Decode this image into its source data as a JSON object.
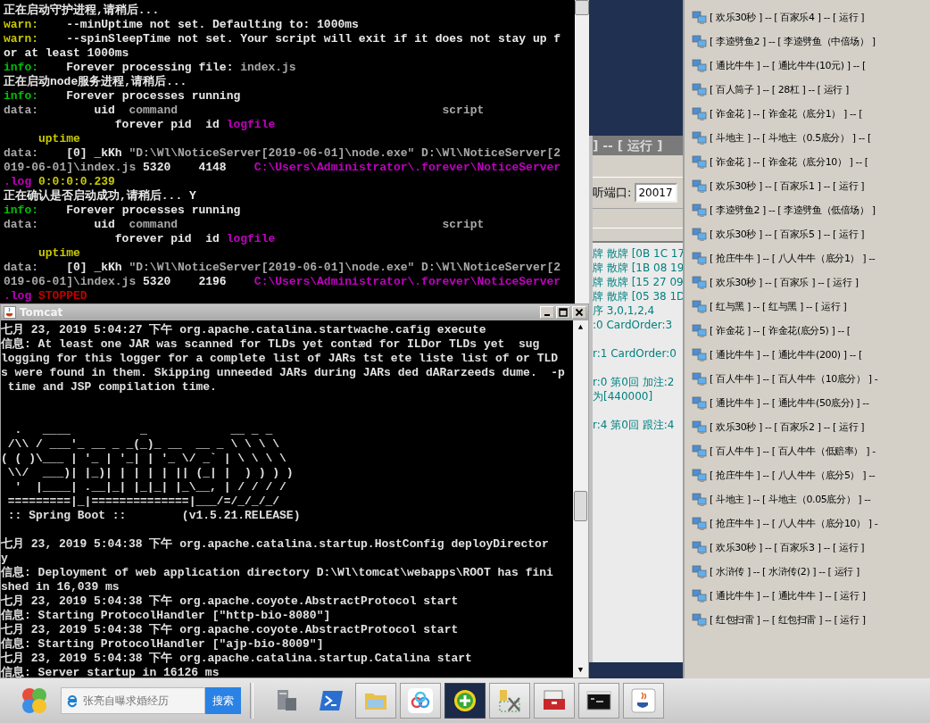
{
  "node_console": {
    "lines": [
      {
        "segments": [
          {
            "kind": "text",
            "text": "正在启动守护进程,请稍后..."
          }
        ]
      },
      {
        "segments": [
          {
            "kind": "warn",
            "text": "warn:"
          },
          {
            "kind": "text",
            "text": "    --minUptime not set. Defaulting to: 1000ms"
          }
        ]
      },
      {
        "segments": [
          {
            "kind": "warn",
            "text": "warn:"
          },
          {
            "kind": "text",
            "text": "    --spinSleepTime not set. Your script will exit if it does not stay up f"
          }
        ]
      },
      {
        "segments": [
          {
            "kind": "text",
            "text": "or at least 1000ms"
          }
        ]
      },
      {
        "segments": [
          {
            "kind": "info",
            "text": "info:"
          },
          {
            "kind": "text",
            "text": "    Forever processing file: "
          },
          {
            "kind": "muted",
            "text": "index.js"
          }
        ]
      },
      {
        "segments": [
          {
            "kind": "text",
            "text": "正在启动node服务进程,请稍后..."
          }
        ]
      },
      {
        "segments": [
          {
            "kind": "info",
            "text": "info:"
          },
          {
            "kind": "text",
            "text": "    Forever processes running"
          }
        ]
      },
      {
        "segments": [
          {
            "kind": "muted",
            "text": "data:"
          },
          {
            "kind": "text",
            "text": "        uid  "
          },
          {
            "kind": "muted",
            "text": "command                                      script"
          }
        ]
      },
      {
        "segments": [
          {
            "kind": "text",
            "text": "                forever pid  id "
          },
          {
            "kind": "path",
            "text": "logfile"
          }
        ]
      },
      {
        "segments": [
          {
            "kind": "warn",
            "text": "     uptime"
          }
        ]
      },
      {
        "segments": [
          {
            "kind": "muted",
            "text": "data:"
          },
          {
            "kind": "text",
            "text": "    [0] _kKh "
          },
          {
            "kind": "muted",
            "text": "\"D:\\Wl\\NoticeServer[2019-06-01]\\node.exe\" D:\\Wl\\NoticeServer[2"
          }
        ]
      },
      {
        "segments": [
          {
            "kind": "muted",
            "text": "019-06-01]\\index.js"
          },
          {
            "kind": "text",
            "text": " 5320    4148    "
          },
          {
            "kind": "path",
            "text": "C:\\Users\\Administrator\\.forever\\NoticeServer"
          }
        ]
      },
      {
        "segments": [
          {
            "kind": "path",
            "text": ".log"
          },
          {
            "kind": "warn",
            "text": " 0:0:0:0.239"
          }
        ]
      },
      {
        "segments": [
          {
            "kind": "text",
            "text": "正在确认是否启动成功,请稍后... Y"
          }
        ]
      },
      {
        "segments": [
          {
            "kind": "info",
            "text": "info:"
          },
          {
            "kind": "text",
            "text": "    Forever processes running"
          }
        ]
      },
      {
        "segments": [
          {
            "kind": "muted",
            "text": "data:"
          },
          {
            "kind": "text",
            "text": "        uid  "
          },
          {
            "kind": "muted",
            "text": "command                                      script"
          }
        ]
      },
      {
        "segments": [
          {
            "kind": "text",
            "text": "                forever pid  id "
          },
          {
            "kind": "path",
            "text": "logfile"
          }
        ]
      },
      {
        "segments": [
          {
            "kind": "warn",
            "text": "     uptime"
          }
        ]
      },
      {
        "segments": [
          {
            "kind": "muted",
            "text": "data:"
          },
          {
            "kind": "text",
            "text": "    [0] _kKh "
          },
          {
            "kind": "muted",
            "text": "\"D:\\Wl\\NoticeServer[2019-06-01]\\node.exe\" D:\\Wl\\NoticeServer[2"
          }
        ]
      },
      {
        "segments": [
          {
            "kind": "muted",
            "text": "019-06-01]\\index.js"
          },
          {
            "kind": "text",
            "text": " 5320    2196    "
          },
          {
            "kind": "path",
            "text": "C:\\Users\\Administrator\\.forever\\NoticeServer"
          }
        ]
      },
      {
        "segments": [
          {
            "kind": "path",
            "text": ".log"
          },
          {
            "kind": "error",
            "text": " STOPPED"
          }
        ]
      }
    ]
  },
  "game_server_window": {
    "title": "] -- [ 运行 ]",
    "port_label": "听端口:",
    "port_value": "20017",
    "log_blocks": [
      [
        "牌 散牌 [0B 1C 17",
        "牌 散牌 [1B 08 19",
        "牌 散牌 [15 27 09",
        "牌 散牌 [05 38 1D",
        "序 3,0,1,2,4",
        ":0 CardOrder:3"
      ],
      [
        "r:1 CardOrder:0"
      ],
      [
        "r:0 第0回 加注:2",
        "为[440000]"
      ],
      [
        "r:4 第0回 跟注:4"
      ]
    ]
  },
  "room_list": [
    "[ 欢乐30秒 ] -- [ 百家乐4 ] -- [ 运行 ]",
    "[ 李逵劈鱼2 ] -- [ 李逵劈鱼（中倍场） ]",
    "[ 通比牛牛 ] -- [ 通比牛牛(10元) ] -- [",
    "[ 百人筒子 ] -- [ 28杠 ] -- [ 运行 ]",
    "[ 诈金花 ] -- [ 诈金花（底分1） ] -- [",
    "[ 斗地主 ] -- [ 斗地主（0.5底分） ] -- [",
    "[ 诈金花 ] -- [ 诈金花（底分10） ] -- [",
    "[ 欢乐30秒 ] -- [ 百家乐1 ] -- [ 运行 ]",
    "[ 李逵劈鱼2 ] -- [ 李逵劈鱼（低倍场） ]",
    "[ 欢乐30秒 ] -- [ 百家乐5 ] -- [ 运行 ]",
    "[ 抢庄牛牛 ] -- [ 八人牛牛（底分1） ] --",
    "[ 欢乐30秒 ] -- [ 百家乐 ] -- [ 运行 ]",
    "[ 红与黑 ] -- [ 红与黑 ] -- [ 运行 ]",
    "[ 诈金花 ] -- [ 诈金花(底分5) ] -- [",
    "[ 通比牛牛 ] -- [ 通比牛牛(200) ] -- [",
    "[ 百人牛牛 ] -- [ 百人牛牛（10底分） ] -",
    "[ 通比牛牛 ] -- [ 通比牛牛(50底分) ] --",
    "[ 欢乐30秒 ] -- [ 百家乐2 ] -- [ 运行 ]",
    "[ 百人牛牛 ] -- [ 百人牛牛（低赔率） ] -",
    "[ 抢庄牛牛 ] -- [ 八人牛牛（底分5） ] --",
    "[ 斗地主 ] -- [ 斗地主（0.05底分） ] --",
    "[ 抢庄牛牛 ] -- [ 八人牛牛（底分10） ] -",
    "[ 欢乐30秒 ] -- [ 百家乐3 ] -- [ 运行 ]",
    "[ 水浒传 ] -- [ 水浒传(2) ] -- [ 运行 ]",
    "[ 通比牛牛 ] -- [ 通比牛牛 ] -- [ 运行 ]",
    "[ 红包扫雷 ] -- [ 红包扫雷 ] -- [ 运行 ]"
  ],
  "tomcat_window": {
    "title": "Tomcat",
    "scroll_up": "▲",
    "scroll_down": "▼",
    "lines": [
      "七月 23, 2019 5:04:27 下午 org.apache.catalina.startwache.cafig execute",
      "信息: At least one JAR was scanned for TLDs yet contæd for ILDor TLDs yet  sug",
      "logging for this logger for a complete list of JARs tst ete liste list of or TLD",
      "s were found in them. Skipping unneeded JARs during JARs ded dARarzeeds dume.  -p",
      " time and JSP compilation time."
    ],
    "banner": [
      "  .   ____          _            __ _ _",
      " /\\\\ / ___'_ __ _ _(_)_ __  __ _ \\ \\ \\ \\",
      "( ( )\\___ | '_ | '_| | '_ \\/ _` | \\ \\ \\ \\",
      " \\\\/  ___)| |_)| | | | | || (_| |  ) ) ) )",
      "  '  |____| .__|_| |_|_| |_\\__, | / / / /",
      " =========|_|==============|___/=/_/_/_/",
      " :: Spring Boot ::        (v1.5.21.RELEASE)"
    ],
    "lines_after": [
      "七月 23, 2019 5:04:38 下午 org.apache.catalina.startup.HostConfig deployDirector",
      "y",
      "信息: Deployment of web application directory D:\\Wl\\tomcat\\webapps\\ROOT has fini",
      "shed in 16,039 ms",
      "七月 23, 2019 5:04:38 下午 org.apache.coyote.AbstractProtocol start",
      "信息: Starting ProtocolHandler [\"http-bio-8080\"]",
      "七月 23, 2019 5:04:38 下午 org.apache.coyote.AbstractProtocol start",
      "信息: Starting ProtocolHandler [\"ajp-bio-8009\"]",
      "七月 23, 2019 5:04:38 下午 org.apache.catalina.startup.Catalina start",
      "信息: Server startup in 16126 ms"
    ]
  },
  "taskbar": {
    "search": {
      "placeholder": "张亮自曝求婚经历",
      "button": "搜索"
    },
    "apps": [
      {
        "kind": "server",
        "selected": false
      },
      {
        "kind": "shell",
        "selected": false
      },
      {
        "kind": "folder",
        "selected": false
      },
      {
        "kind": "cloud",
        "selected": false
      },
      {
        "kind": "plus",
        "selected": true
      },
      {
        "kind": "tools",
        "selected": false
      },
      {
        "kind": "toolbox",
        "selected": false
      },
      {
        "kind": "terminal",
        "selected": false
      },
      {
        "kind": "java",
        "selected": false
      }
    ]
  }
}
